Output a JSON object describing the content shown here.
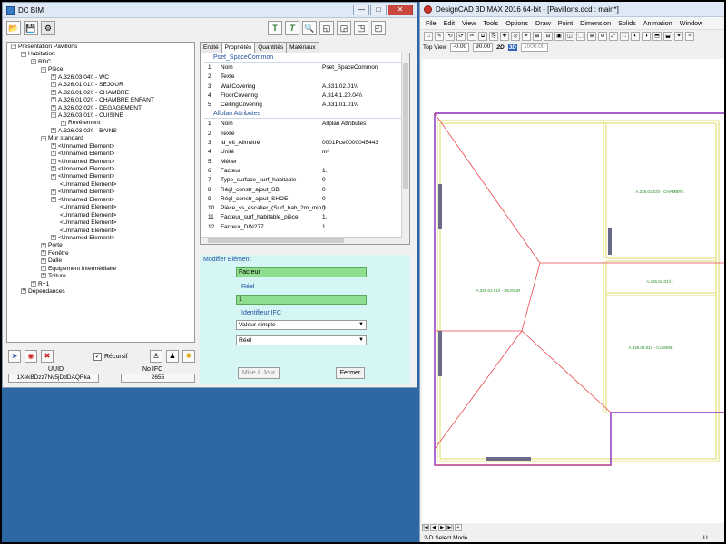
{
  "bim": {
    "title": "DC BIM",
    "win_minimize": "—",
    "win_maximize": "□",
    "win_close": "✕",
    "toolbar": {
      "open_icon": "📂",
      "save_icon": "💾",
      "settings_icon": "⚙",
      "text_t": "T",
      "text_edit": "T",
      "search_icon": "🔍"
    },
    "tree": [
      {
        "label": "Présentation Pavillons",
        "level": 0,
        "exp": "−"
      },
      {
        "label": "Habitation",
        "level": 1,
        "exp": "−"
      },
      {
        "label": "RDC",
        "level": 2,
        "exp": "−"
      },
      {
        "label": "Pièce",
        "level": 3,
        "exp": "−"
      },
      {
        "label": "A.326.03.04\\\\ - WC",
        "level": 4,
        "exp": "+"
      },
      {
        "label": "A.326.01.01\\\\ - SEJOUR",
        "level": 4,
        "exp": "+"
      },
      {
        "label": "A.326.01.02\\\\ - CHAMBRE",
        "level": 4,
        "exp": "+"
      },
      {
        "label": "A.326.01.02\\\\ - CHAMBRE ENFANT",
        "level": 4,
        "exp": "+"
      },
      {
        "label": "A.326.02.02\\\\ - DEGAGEMENT",
        "level": 4,
        "exp": "+"
      },
      {
        "label": "A.326.03.01\\\\ - CUISINE",
        "level": 4,
        "exp": "−"
      },
      {
        "label": "Revêtement",
        "level": 5,
        "exp": "+"
      },
      {
        "label": "A.326.03.02\\\\ - BAINS",
        "level": 4,
        "exp": "+"
      },
      {
        "label": "Mur standard",
        "level": 3,
        "exp": "−"
      },
      {
        "label": "<Unnamed Element>",
        "level": 4,
        "exp": "+"
      },
      {
        "label": "<Unnamed Element>",
        "level": 4,
        "exp": "+"
      },
      {
        "label": "<Unnamed Element>",
        "level": 4,
        "exp": "+"
      },
      {
        "label": "<Unnamed Element>",
        "level": 4,
        "exp": "+"
      },
      {
        "label": "<Unnamed Element>",
        "level": 4,
        "exp": "+"
      },
      {
        "label": "<Unnamed Element>",
        "level": 4,
        "exp": ""
      },
      {
        "label": "<Unnamed Element>",
        "level": 4,
        "exp": "+"
      },
      {
        "label": "<Unnamed Element>",
        "level": 4,
        "exp": "+"
      },
      {
        "label": "<Unnamed Element>",
        "level": 4,
        "exp": ""
      },
      {
        "label": "<Unnamed Element>",
        "level": 4,
        "exp": ""
      },
      {
        "label": "<Unnamed Element>",
        "level": 4,
        "exp": ""
      },
      {
        "label": "<Unnamed Element>",
        "level": 4,
        "exp": ""
      },
      {
        "label": "<Unnamed Element>",
        "level": 4,
        "exp": "+"
      },
      {
        "label": "Porte",
        "level": 3,
        "exp": "+"
      },
      {
        "label": "Fenêtre",
        "level": 3,
        "exp": "+"
      },
      {
        "label": "Dalle",
        "level": 3,
        "exp": "+"
      },
      {
        "label": "Equipement intermédiaire",
        "level": 3,
        "exp": "+"
      },
      {
        "label": "Toiture",
        "level": 3,
        "exp": "+"
      },
      {
        "label": "R+1",
        "level": 2,
        "exp": "+"
      },
      {
        "label": "Dépendances",
        "level": 1,
        "exp": "+"
      }
    ],
    "bottom": {
      "recursive_label": "Récursif",
      "recursive_checked": "✓",
      "uuid_label": "UUID",
      "uuid_value": "1XekBDzz7Nv5jDdDAQRka",
      "ifc_label": "No IFC",
      "ifc_value": "2655"
    },
    "tabs": [
      "Entité",
      "Propriétés",
      "Quantités",
      "Matériaux"
    ],
    "sections": [
      {
        "title": "Pset_SpaceCommon",
        "rows": [
          {
            "n": "1",
            "k": "Nom",
            "v": "Pset_SpaceCommon"
          },
          {
            "n": "2",
            "k": "Texte",
            "v": ""
          },
          {
            "n": "3",
            "k": "WallCovering",
            "v": "A.331.02.01\\\\"
          },
          {
            "n": "4",
            "k": "FloorCovering",
            "v": "A.314.1.20.04\\\\"
          },
          {
            "n": "5",
            "k": "CeilingCovering",
            "v": "A.331.01.01\\\\"
          }
        ]
      },
      {
        "title": "Allplan Attributes",
        "rows": [
          {
            "n": "1",
            "k": "Nom",
            "v": "Allplan Attributes"
          },
          {
            "n": "2",
            "k": "Texte",
            "v": ""
          },
          {
            "n": "3",
            "k": "Id_élt_Allmétré",
            "v": "0001Pce0000045443"
          },
          {
            "n": "4",
            "k": "Unité",
            "v": "m²"
          },
          {
            "n": "5",
            "k": "Métier",
            "v": ""
          },
          {
            "n": "6",
            "k": "Facteur",
            "v": "1."
          },
          {
            "n": "7",
            "k": "Type_surface_surf_habitable",
            "v": "0"
          },
          {
            "n": "8",
            "k": "Régl_constr_ajout_SB",
            "v": "0"
          },
          {
            "n": "9",
            "k": "Régl_constr_ajout_SHOE",
            "v": "0"
          },
          {
            "n": "10",
            "k": "Pièce_ss_escalier_(Surf_hab_2m_min.)",
            "v": "0"
          },
          {
            "n": "11",
            "k": "Facteur_surf_habitable_pièce",
            "v": "1."
          },
          {
            "n": "12",
            "k": "Facteur_DIN277",
            "v": "1."
          }
        ]
      }
    ],
    "modif": {
      "title": "Modifier Elément",
      "name_value": "Facteur",
      "reel_label": "Réel",
      "reel_value": "1",
      "ifc_id_label": "Identifieur IFC",
      "select1": "Valeur simple",
      "select2": "Réel",
      "arrow": "▼",
      "update_btn": "Mise à Jour",
      "close_btn": "Fermer"
    }
  },
  "cad": {
    "title": "DesignCAD 3D MAX 2016 64-bit - [Pavillons.dcd : main*]",
    "menu": [
      "File",
      "Edit",
      "View",
      "Tools",
      "Options",
      "Draw",
      "Point",
      "Dimension",
      "Solids",
      "Animation",
      "Window"
    ],
    "view_name": "Top View",
    "coord1": "-0.00",
    "coord2": "90.00",
    "coord3": "1000.00",
    "btn_2d": "2D",
    "btn_3d": "3D",
    "rooms": [
      {
        "label": "A.326.01.02\\\\ - CHAMBRE"
      },
      {
        "label": "A.326.01.01\\\\ - SEJOUR"
      },
      {
        "label": "A.326.02.01\\\\ -"
      },
      {
        "label": "A.326.03.01\\\\ - CUISINE"
      }
    ],
    "status": "2-D Select Mode",
    "status_right": "U"
  },
  "colors": {
    "desktop": "#2f66a4",
    "modif_bg": "#d6f6f6",
    "green_field": "#8fdd8f",
    "wall_outline": "#8b2bbf",
    "roof_lines": "#e8474f",
    "wall_fill": "#d8d040",
    "room_label": "#1f8a1f"
  }
}
